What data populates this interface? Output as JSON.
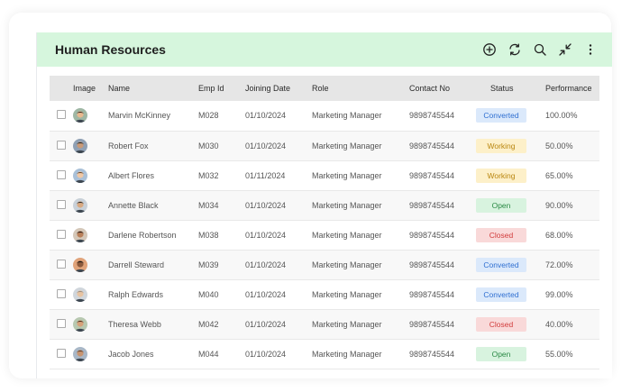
{
  "header": {
    "title": "Human Resources",
    "icons": [
      "add-circle-icon",
      "refresh-icon",
      "search-icon",
      "collapse-icon",
      "more-vertical-icon"
    ]
  },
  "table": {
    "columns": {
      "image": "Image",
      "name": "Name",
      "emp_id": "Emp Id",
      "joining_date": "Joining Date",
      "role": "Role",
      "contact": "Contact No",
      "status": "Status",
      "performance": "Performance"
    },
    "rows": [
      {
        "name": "Marvin McKinney",
        "emp_id": "M028",
        "joining_date": "01/10/2024",
        "role": "Marketing Manager",
        "contact": "9898745544",
        "status": "Converted",
        "performance": "100.00%"
      },
      {
        "name": "Robert Fox",
        "emp_id": "M030",
        "joining_date": "01/10/2024",
        "role": "Marketing Manager",
        "contact": "9898745544",
        "status": "Working",
        "performance": "50.00%"
      },
      {
        "name": "Albert Flores",
        "emp_id": "M032",
        "joining_date": "01/11/2024",
        "role": "Marketing Manager",
        "contact": "9898745544",
        "status": "Working",
        "performance": "65.00%"
      },
      {
        "name": "Annette Black",
        "emp_id": "M034",
        "joining_date": "01/10/2024",
        "role": "Marketing Manager",
        "contact": "9898745544",
        "status": "Open",
        "performance": "90.00%"
      },
      {
        "name": "Darlene Robertson",
        "emp_id": "M038",
        "joining_date": "01/10/2024",
        "role": "Marketing Manager",
        "contact": "9898745544",
        "status": "Closed",
        "performance": "68.00%"
      },
      {
        "name": "Darrell Steward",
        "emp_id": "M039",
        "joining_date": "01/10/2024",
        "role": "Marketing Manager",
        "contact": "9898745544",
        "status": "Converted",
        "performance": "72.00%"
      },
      {
        "name": "Ralph Edwards",
        "emp_id": "M040",
        "joining_date": "01/10/2024",
        "role": "Marketing Manager",
        "contact": "9898745544",
        "status": "Converted",
        "performance": "99.00%"
      },
      {
        "name": "Theresa Webb",
        "emp_id": "M042",
        "joining_date": "01/10/2024",
        "role": "Marketing Manager",
        "contact": "9898745544",
        "status": "Closed",
        "performance": "40.00%"
      },
      {
        "name": "Jacob Jones",
        "emp_id": "M044",
        "joining_date": "01/10/2024",
        "role": "Marketing Manager",
        "contact": "9898745544",
        "status": "Open",
        "performance": "55.00%"
      }
    ]
  },
  "status_colors": {
    "Converted": {
      "bg": "#dbe9fb",
      "fg": "#2f6fd1"
    },
    "Working": {
      "bg": "#fdf0c9",
      "fg": "#b9860f"
    },
    "Open": {
      "bg": "#d8f3df",
      "fg": "#2a8a45"
    },
    "Closed": {
      "bg": "#f9d9d9",
      "fg": "#d23c3c"
    }
  },
  "theme": {
    "header_bg": "#d6f6dd",
    "table_header_bg": "#e6e6e6"
  }
}
